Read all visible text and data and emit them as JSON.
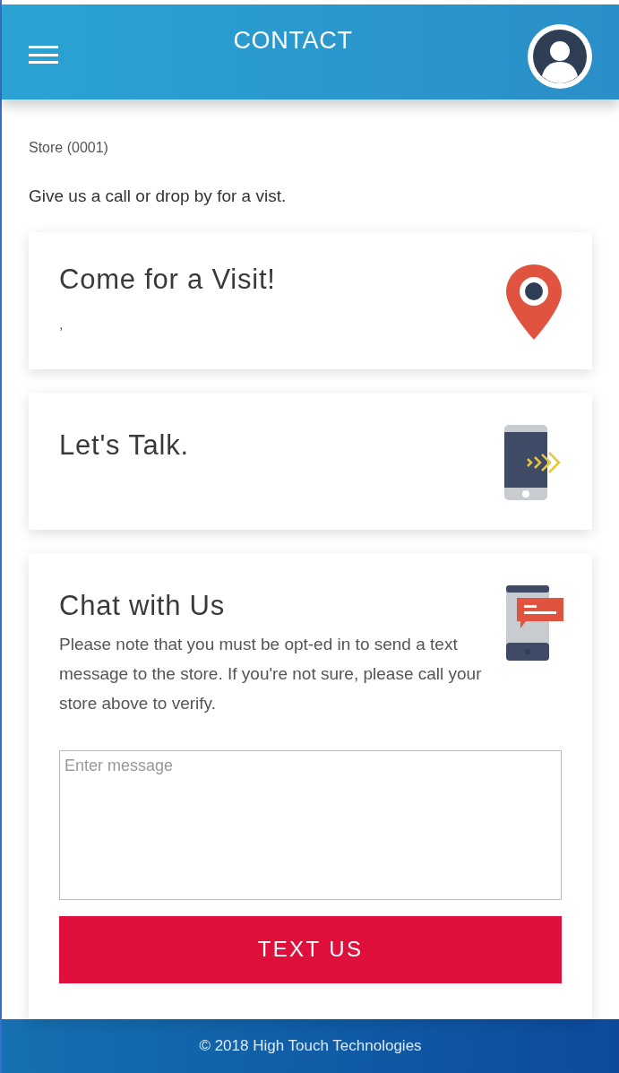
{
  "header": {
    "title": "CONTACT"
  },
  "store_label": "Store (0001)",
  "intro": "Give us a call or drop by for a vist.",
  "cards": [
    {
      "kind": "visit",
      "title": "Come for a Visit!",
      "detail": ","
    },
    {
      "kind": "talk",
      "title": "Let's Talk."
    },
    {
      "kind": "chat",
      "title": "Chat with Us",
      "body": "Please note that you must be opt-ed in to send a text message to the store. If you're not sure, please call your store above to verify.",
      "message": {
        "placeholder": "Enter message"
      },
      "button": "TEXT US"
    }
  ],
  "footer": "© 2018 High Touch Technologies"
}
